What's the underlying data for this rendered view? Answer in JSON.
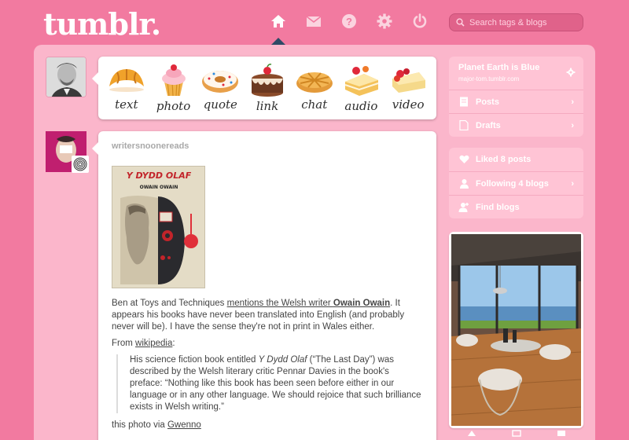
{
  "header": {
    "logo": "tumblr.",
    "nav": [
      {
        "icon": "home-icon"
      },
      {
        "icon": "mail-icon"
      },
      {
        "icon": "help-icon"
      },
      {
        "icon": "gear-icon"
      },
      {
        "icon": "power-icon"
      }
    ],
    "search_placeholder": "Search tags & blogs",
    "search_value": ""
  },
  "post_types": [
    {
      "label": "text",
      "icon": "croissant-icon"
    },
    {
      "label": "photo",
      "icon": "cupcake-icon"
    },
    {
      "label": "quote",
      "icon": "donut-icon"
    },
    {
      "label": "link",
      "icon": "cake-icon"
    },
    {
      "label": "chat",
      "icon": "pie-icon"
    },
    {
      "label": "audio",
      "icon": "cake-slice-icon"
    },
    {
      "label": "video",
      "icon": "cheesecake-icon"
    }
  ],
  "post": {
    "author": "writersnoonereads",
    "book_title": "Y DYDD OLAF",
    "book_author": "OWAIN OWAIN",
    "para1_pre": "Ben at Toys and Techniques ",
    "para1_link": "mentions the Welsh writer ",
    "para1_link_bold": "Owain Owain",
    "para1_post": ". It appears his books have never been translated into English (and probably never will be). I have the sense they're not in print in Wales either.",
    "from_pre": "From ",
    "from_link": "wikipedia",
    "from_post": ":",
    "quote_pre": "His science fiction book entitled ",
    "quote_italic": "Y Dydd Olaf",
    "quote_post": " (“The Last Day”) was described by the Welsh literary critic Pennar Davies in the book's preface: “Nothing like this book has been seen before either in our language or in any other language. We should rejoice that such brilliance exists in Welsh writing.”",
    "via_pre": "this photo via ",
    "via_link": "Gwenno"
  },
  "sidebar": {
    "blog_title": "Planet Earth is Blue",
    "blog_url": "major-tom.tumblr.com",
    "blog_rows": [
      {
        "label": "Posts",
        "icon": "posts-icon"
      },
      {
        "label": "Drafts",
        "icon": "drafts-icon"
      }
    ],
    "activity_rows": [
      {
        "label": "Liked 8 posts",
        "icon": "heart-icon"
      },
      {
        "label": "Following 4 blogs",
        "icon": "person-icon"
      },
      {
        "label": "Find blogs",
        "icon": "add-person-icon"
      }
    ]
  },
  "colors": {
    "background": "#f27aa0",
    "panel": "#fbb6cb",
    "sidebar_box": "#ffc4d5",
    "nav_pointer": "#2f4a66"
  }
}
